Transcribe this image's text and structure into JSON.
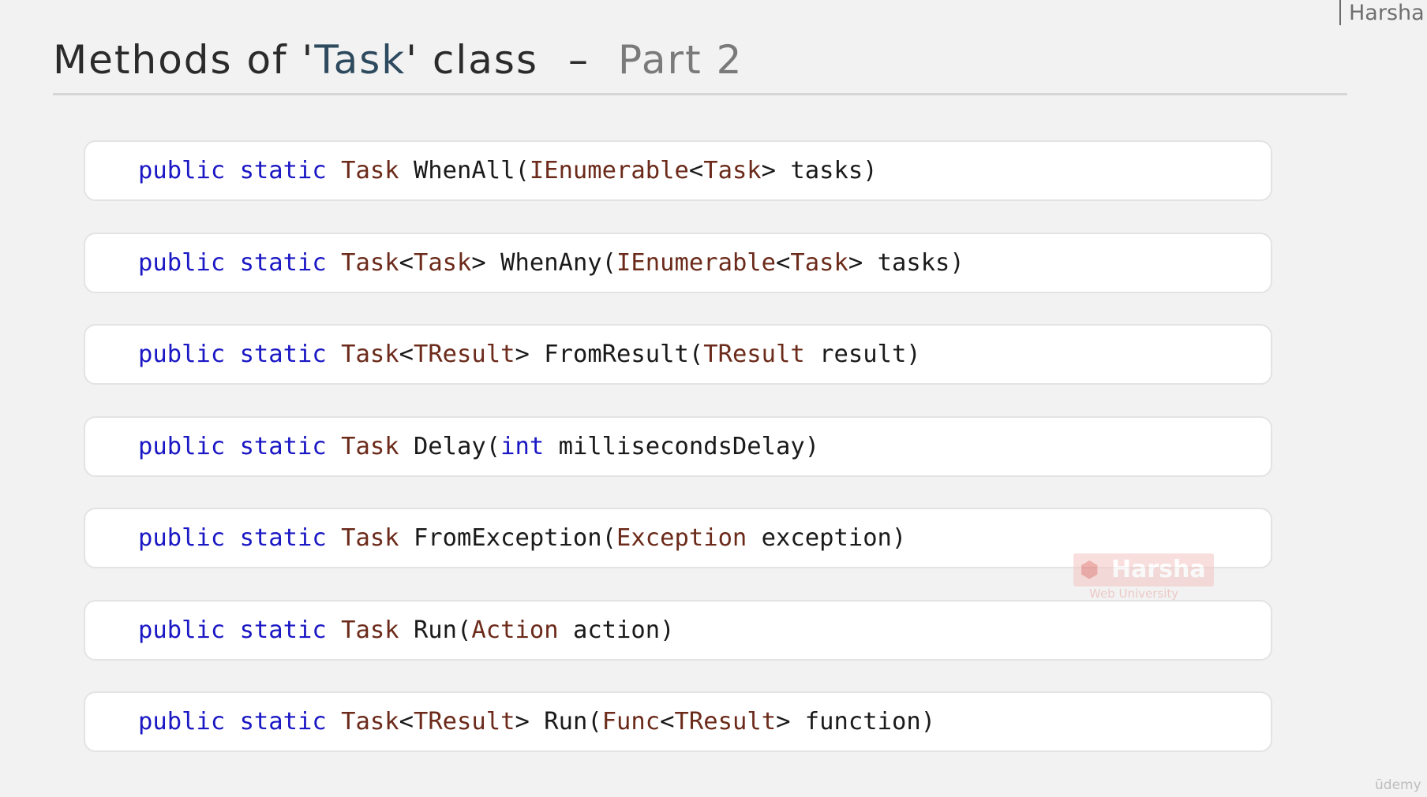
{
  "author_tag": "Harsha",
  "title": {
    "prefix": "Methods of '",
    "class_name": "Task",
    "suffix": "' class",
    "separator": "–",
    "part": "Part 2"
  },
  "methods": [
    [
      {
        "t": "public",
        "k": "kw"
      },
      {
        "t": " "
      },
      {
        "t": "static",
        "k": "kw"
      },
      {
        "t": " "
      },
      {
        "t": "Task",
        "k": "ty"
      },
      {
        "t": " WhenAll("
      },
      {
        "t": "IEnumerable",
        "k": "ty"
      },
      {
        "t": "<"
      },
      {
        "t": "Task",
        "k": "ty"
      },
      {
        "t": "> tasks)"
      }
    ],
    [
      {
        "t": "public",
        "k": "kw"
      },
      {
        "t": " "
      },
      {
        "t": "static",
        "k": "kw"
      },
      {
        "t": " "
      },
      {
        "t": "Task",
        "k": "ty"
      },
      {
        "t": "<"
      },
      {
        "t": "Task",
        "k": "ty"
      },
      {
        "t": "> WhenAny("
      },
      {
        "t": "IEnumerable",
        "k": "ty"
      },
      {
        "t": "<"
      },
      {
        "t": "Task",
        "k": "ty"
      },
      {
        "t": "> tasks)"
      }
    ],
    [
      {
        "t": "public",
        "k": "kw"
      },
      {
        "t": " "
      },
      {
        "t": "static",
        "k": "kw"
      },
      {
        "t": " "
      },
      {
        "t": "Task",
        "k": "ty"
      },
      {
        "t": "<"
      },
      {
        "t": "TResult",
        "k": "ty"
      },
      {
        "t": "> FromResult("
      },
      {
        "t": "TResult",
        "k": "ty"
      },
      {
        "t": " result)"
      }
    ],
    [
      {
        "t": "public",
        "k": "kw"
      },
      {
        "t": " "
      },
      {
        "t": "static",
        "k": "kw"
      },
      {
        "t": " "
      },
      {
        "t": "Task",
        "k": "ty"
      },
      {
        "t": " Delay("
      },
      {
        "t": "int",
        "k": "kw"
      },
      {
        "t": " millisecondsDelay)"
      }
    ],
    [
      {
        "t": "public",
        "k": "kw"
      },
      {
        "t": " "
      },
      {
        "t": "static",
        "k": "kw"
      },
      {
        "t": " "
      },
      {
        "t": "Task",
        "k": "ty"
      },
      {
        "t": " FromException("
      },
      {
        "t": "Exception",
        "k": "ty"
      },
      {
        "t": " exception)"
      }
    ],
    [
      {
        "t": "public",
        "k": "kw"
      },
      {
        "t": " "
      },
      {
        "t": "static",
        "k": "kw"
      },
      {
        "t": " "
      },
      {
        "t": "Task",
        "k": "ty"
      },
      {
        "t": " Run("
      },
      {
        "t": "Action",
        "k": "ty"
      },
      {
        "t": " action)"
      }
    ],
    [
      {
        "t": "public",
        "k": "kw"
      },
      {
        "t": " "
      },
      {
        "t": "static",
        "k": "kw"
      },
      {
        "t": " "
      },
      {
        "t": "Task",
        "k": "ty"
      },
      {
        "t": "<"
      },
      {
        "t": "TResult",
        "k": "ty"
      },
      {
        "t": "> Run("
      },
      {
        "t": "Func",
        "k": "ty"
      },
      {
        "t": "<"
      },
      {
        "t": "TResult",
        "k": "ty"
      },
      {
        "t": "> function)"
      }
    ]
  ],
  "watermark": {
    "name": "Harsha",
    "subtitle": "Web University",
    "logo_icon": "hexagon-logo-icon"
  },
  "platform_mark": "ūdemy",
  "colors": {
    "background": "#f2f2f2",
    "keyword": "#1a17c4",
    "type": "#6b2a1a",
    "plain": "#1a1a1a",
    "title": "#2b2b2b",
    "title_class": "#2d4a5e",
    "title_part": "#7a7a7a"
  }
}
